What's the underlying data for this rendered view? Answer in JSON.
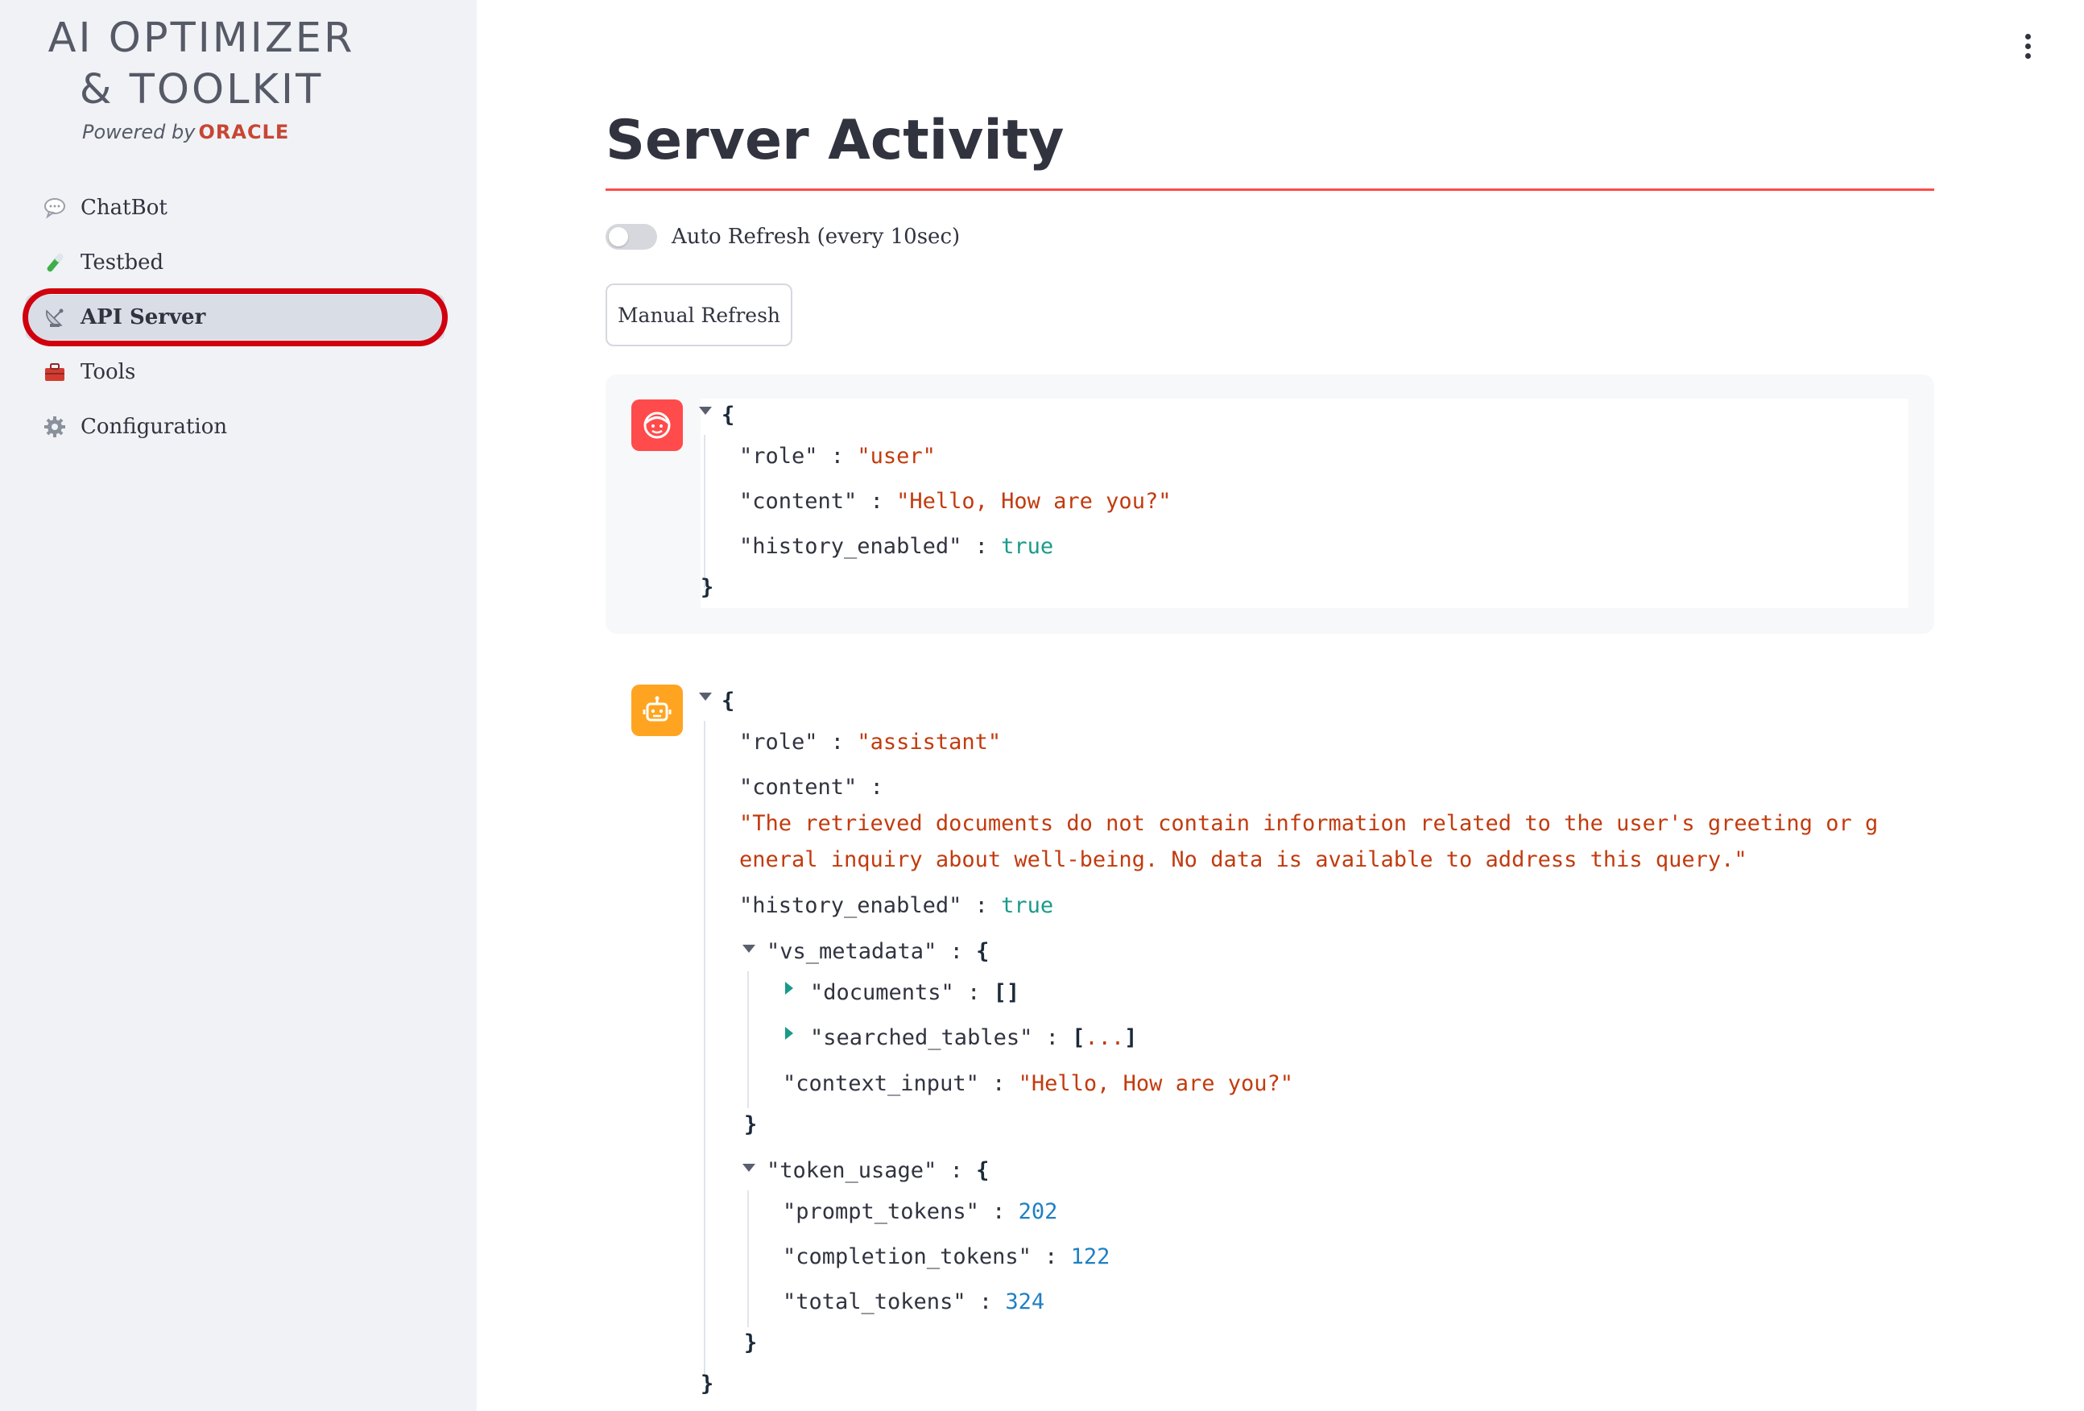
{
  "sidebar": {
    "logo_line1": "AI OPTIMIZER",
    "logo_line2": "& TOOLKIT",
    "powered_by": "Powered by",
    "brand": "ORACLE",
    "items": [
      {
        "label": "ChatBot",
        "icon": "speech-bubble-icon"
      },
      {
        "label": "Testbed",
        "icon": "test-tube-icon"
      },
      {
        "label": "API Server",
        "icon": "satellite-dish-icon",
        "active": true
      },
      {
        "label": "Tools",
        "icon": "toolbox-icon"
      },
      {
        "label": "Configuration",
        "icon": "gear-icon"
      }
    ]
  },
  "main": {
    "title": "Server Activity",
    "auto_refresh_label": "Auto Refresh (every 10sec)",
    "auto_refresh_on": false,
    "manual_refresh_label": "Manual Refresh"
  },
  "messages": [
    {
      "avatar": "user-face-icon",
      "role_key": "\"role\"",
      "role": "\"user\"",
      "content_key": "\"content\"",
      "content": "\"Hello, How are you?\"",
      "history_key": "\"history_enabled\"",
      "history_enabled": "true"
    },
    {
      "avatar": "robot-icon",
      "role_key": "\"role\"",
      "role": "\"assistant\"",
      "content_key": "\"content\"",
      "content_line1": "\"The retrieved documents do not contain information related to the user's greeting or g",
      "content_line2": "eneral inquiry about well-being. No data is available to address this query.\"",
      "history_key": "\"history_enabled\"",
      "history_enabled": "true",
      "vs_metadata_key": "\"vs_metadata\"",
      "documents_key": "\"documents\"",
      "documents": "[]",
      "searched_tables_key": "\"searched_tables\"",
      "searched_tables_open": "[",
      "searched_tables_ellipsis": "...",
      "searched_tables_close": "]",
      "context_input_key": "\"context_input\"",
      "context_input": "\"Hello, How are you?\"",
      "token_usage_key": "\"token_usage\"",
      "prompt_tokens_key": "\"prompt_tokens\"",
      "prompt_tokens": "202",
      "completion_tokens_key": "\"completion_tokens\"",
      "completion_tokens": "122",
      "total_tokens_key": "\"total_tokens\"",
      "total_tokens": "324"
    }
  ],
  "colors": {
    "accent": "#ff4b4b",
    "highlight_circle": "#d0000e",
    "string": "#c23b0e",
    "boolean": "#1a9a8a",
    "number": "#1f7fc4",
    "user_avatar": "#ff4b4b",
    "bot_avatar": "#ffa421"
  }
}
